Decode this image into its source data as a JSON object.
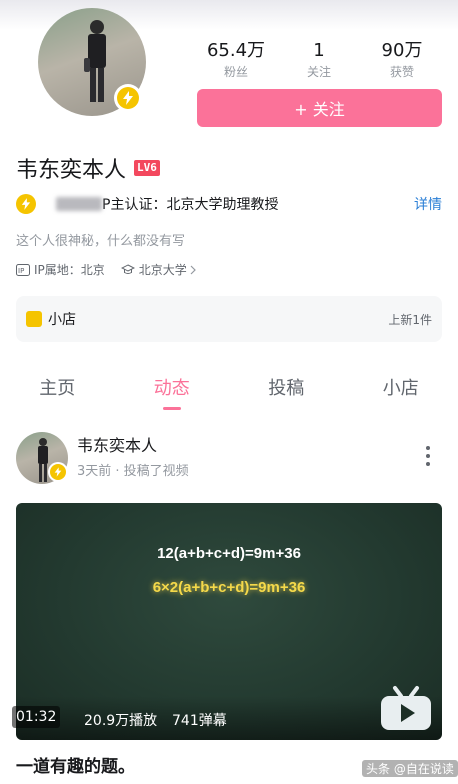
{
  "profile": {
    "name": "韦东奕本人",
    "level": "LV6",
    "stats": [
      {
        "value": "65.4万",
        "label": "粉丝"
      },
      {
        "value": "1",
        "label": "关注"
      },
      {
        "value": "90万",
        "label": "获赞"
      }
    ],
    "follow_label": "+ 关注",
    "certification": "P主认证：北京大学助理教授",
    "detail_label": "详情",
    "bio": "这个人很神秘，什么都没有写",
    "ip_location": "IP属地：北京",
    "school": "北京大学",
    "shop": {
      "label": "小店",
      "new_items": "上新1件"
    }
  },
  "tabs": [
    {
      "label": "主页"
    },
    {
      "label": "动态"
    },
    {
      "label": "投稿"
    },
    {
      "label": "小店"
    }
  ],
  "post": {
    "author": "韦东奕本人",
    "meta": "3天前 · 投稿了视频",
    "video": {
      "equation_1": "12(a+b+c+d)=9m+36",
      "equation_2": "6×2(a+b+c+d)=9m+36",
      "duration": "01:32",
      "plays": "20.9万播放",
      "danmaku": "741弹幕"
    },
    "title": "一道有趣的题。"
  },
  "watermark": "头条 @自在说读",
  "colors": {
    "accent": "#fb7299",
    "badge": "#f5c400",
    "link": "#2b7fd6",
    "level": "#f3485e"
  }
}
